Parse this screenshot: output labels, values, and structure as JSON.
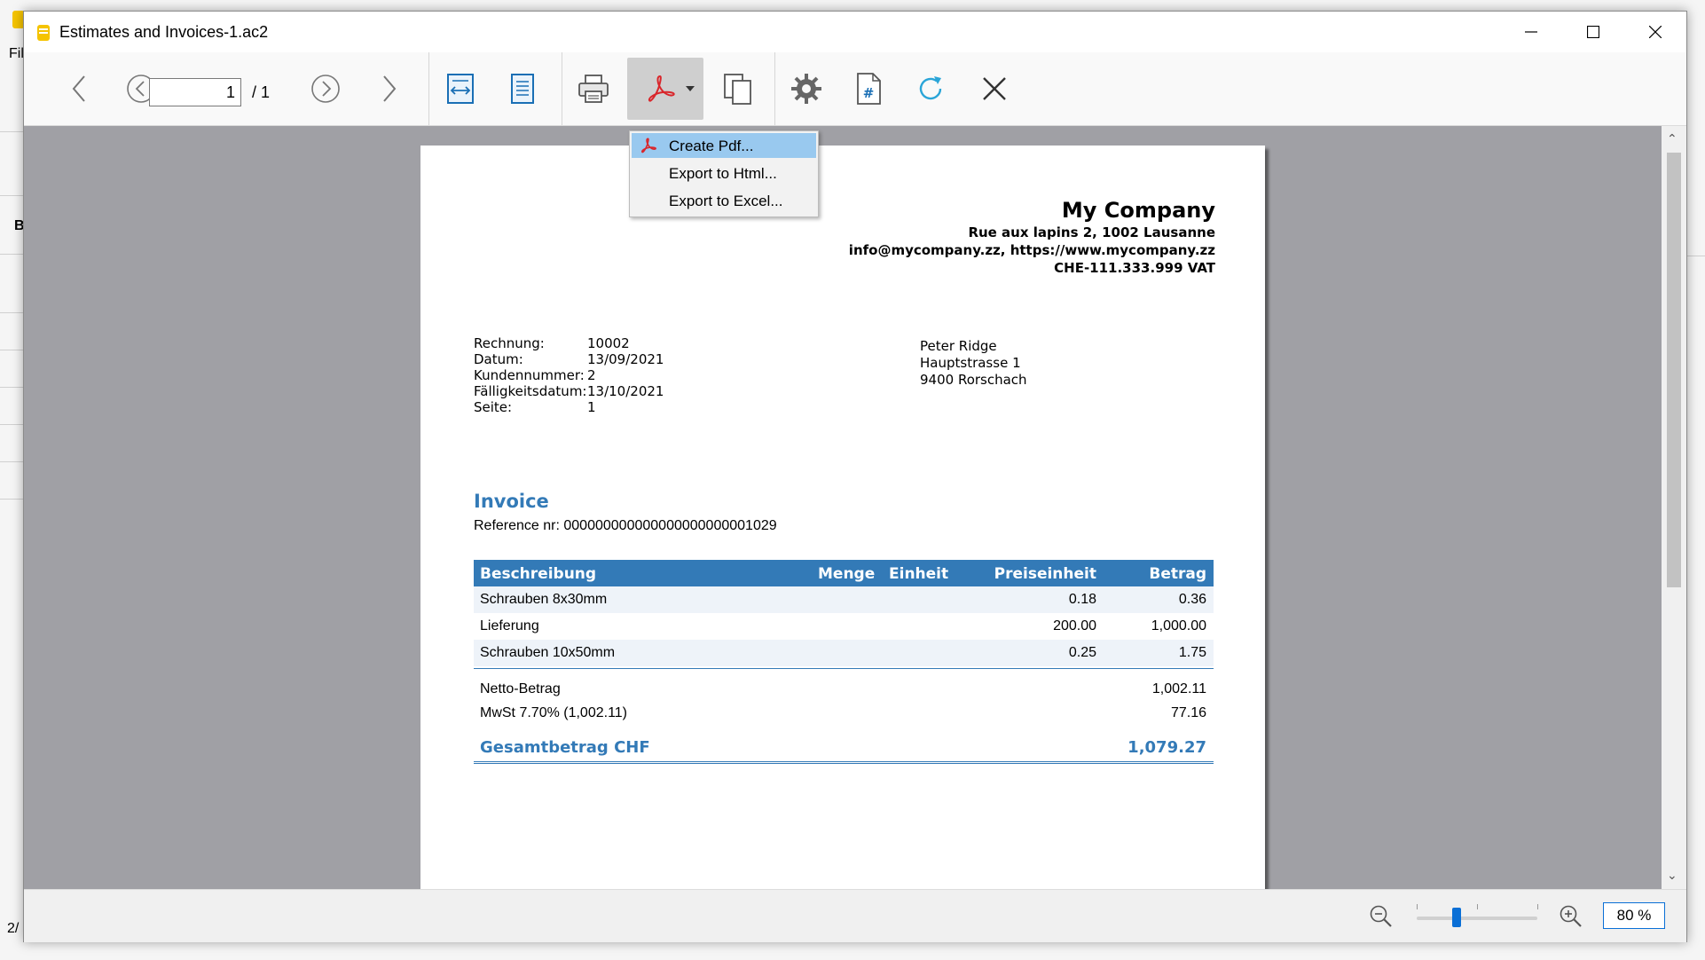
{
  "background": {
    "menu_fragment": "Fil",
    "letter_fragment": "B",
    "status_fragment": "2/"
  },
  "window": {
    "title": "Estimates and Invoices-1.ac2"
  },
  "toolbar": {
    "page_value": "1",
    "page_total": "/ 1"
  },
  "export_menu": {
    "items": [
      {
        "label": "Create Pdf..."
      },
      {
        "label": "Export to Html..."
      },
      {
        "label": "Export to Excel..."
      }
    ]
  },
  "document": {
    "company": {
      "name": "My Company",
      "address": "Rue aux lapins 2, 1002 Lausanne",
      "contact": "info@mycompany.zz, https://www.mycompany.zz",
      "vat": "CHE-111.333.999 VAT"
    },
    "meta": [
      {
        "key": "Rechnung:",
        "value": "10002"
      },
      {
        "key": "Datum:",
        "value": "13/09/2021"
      },
      {
        "key": "Kundennummer:",
        "value": "2"
      },
      {
        "key": "Fälligkeitsdatum:",
        "value": "13/10/2021"
      },
      {
        "key": "Seite:",
        "value": "1"
      }
    ],
    "customer": {
      "name": "Peter Ridge",
      "street": "Hauptstrasse 1",
      "city": "9400 Rorschach"
    },
    "title": "Invoice",
    "reference": "Reference nr: 000000000000000000000001029",
    "table": {
      "headers": {
        "description": "Beschreibung",
        "quantity": "Menge",
        "unit": "Einheit",
        "unit_price": "Preiseinheit",
        "amount": "Betrag"
      },
      "rows": [
        {
          "description": "Schrauben 8x30mm",
          "unit_price": "0.18",
          "amount": "0.36"
        },
        {
          "description": "Lieferung",
          "unit_price": "200.00",
          "amount": "1,000.00"
        },
        {
          "description": "Schrauben 10x50mm",
          "unit_price": "0.25",
          "amount": "1.75"
        }
      ],
      "net_label": "Netto-Betrag",
      "net_value": "1,002.11",
      "vat_label": "MwSt 7.70% (1,002.11)",
      "vat_value": "77.16",
      "total_label": "Gesamtbetrag CHF",
      "total_value": "1,079.27"
    }
  },
  "zoom": {
    "value": "80  %",
    "slider_position": 0.33
  },
  "colors": {
    "accent": "#337ab7",
    "viewer_bg": "#a0a0a5",
    "menu_highlight": "#99c9ef",
    "pdf_red": "#d9262b"
  }
}
